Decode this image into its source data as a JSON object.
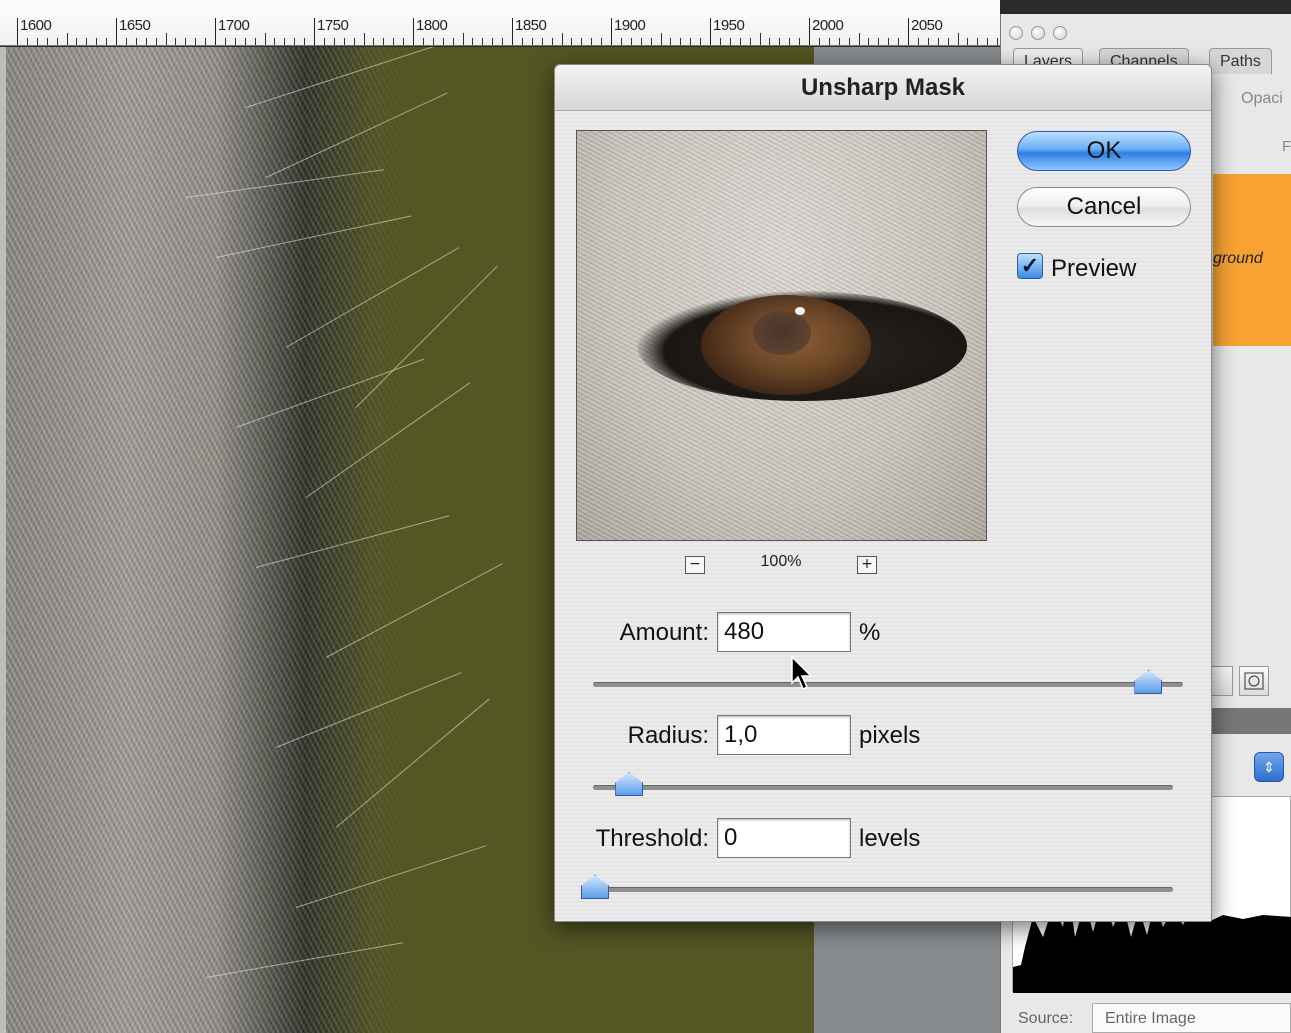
{
  "ruler": {
    "labels": [
      "1600",
      "1650",
      "1700",
      "1750",
      "1800",
      "1850",
      "1900",
      "1950",
      "2000",
      "2050"
    ]
  },
  "layers_panel": {
    "tabs": [
      "Layers",
      "Channels",
      "Paths"
    ],
    "opacity_label": "Opaci",
    "fill_label": "F",
    "layer_name": "ground"
  },
  "histogram": {
    "source_label": "Source:",
    "source_value": "Entire Image"
  },
  "dialog": {
    "title": "Unsharp Mask",
    "ok_label": "OK",
    "cancel_label": "Cancel",
    "preview_label": "Preview",
    "preview_checked": true,
    "zoom_out_symbol": "−",
    "zoom_in_symbol": "+",
    "zoom_level": "100%",
    "amount": {
      "label": "Amount:",
      "value": "480",
      "unit": "%",
      "slider_fraction": 0.96
    },
    "radius": {
      "label": "Radius:",
      "value": "1,0",
      "unit": "pixels",
      "slider_fraction": 0.04
    },
    "threshold": {
      "label": "Threshold:",
      "value": "0",
      "unit": "levels",
      "slider_fraction": 0.0
    }
  },
  "colors": {
    "accent_blue": "#2e7fe0",
    "layer_highlight": "#f7a232",
    "background_olive": "#545624"
  }
}
